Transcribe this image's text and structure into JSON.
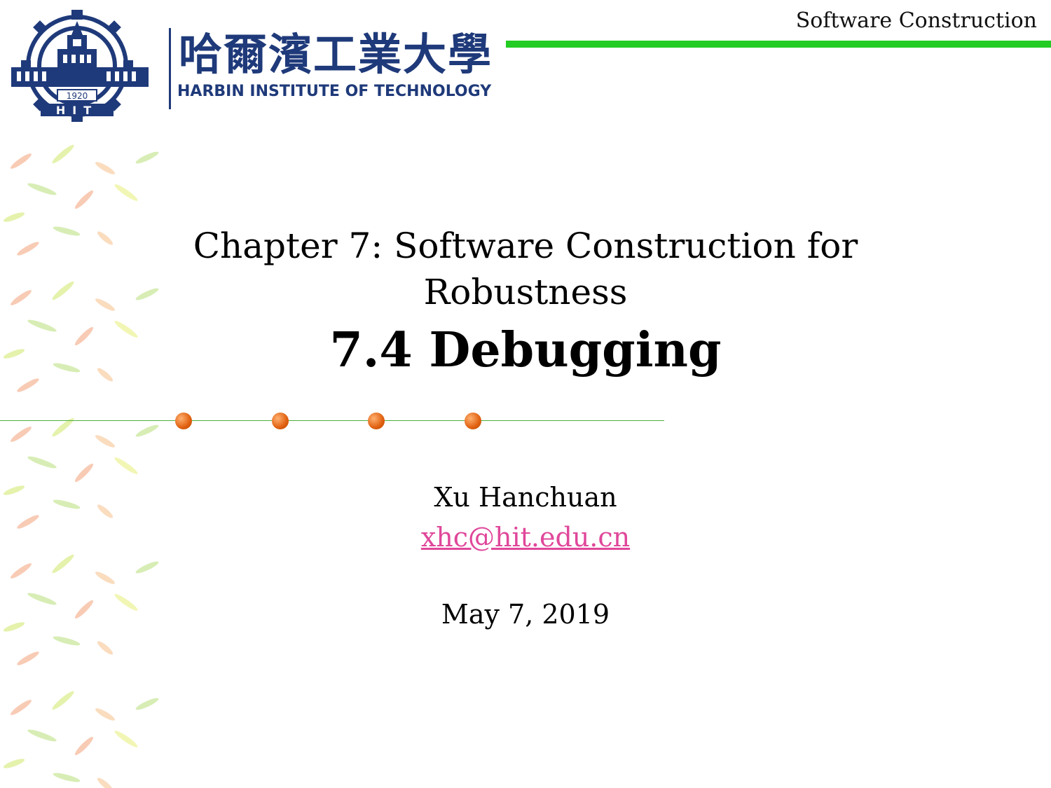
{
  "header": {
    "course_title": "Software Construction",
    "accent_color": "#22cc22"
  },
  "logo": {
    "seal_year": "1920",
    "seal_letters": "HIT",
    "name_cn": "哈爾濱工業大學",
    "name_en": "HARBIN INSTITUTE OF TECHNOLOGY",
    "brand_color": "#1f3a7a"
  },
  "slide": {
    "chapter_line1": "Chapter 7: Software Construction for",
    "chapter_line2": "Robustness",
    "section_title": "7.4 Debugging",
    "author": "Xu Hanchuan",
    "email": "xhc@hit.edu.cn",
    "date": "May 7, 2019"
  },
  "decoration": {
    "divider_color": "#4caf3a",
    "dot_color": "#e06010",
    "leaf_icon": "leaf-pattern"
  }
}
